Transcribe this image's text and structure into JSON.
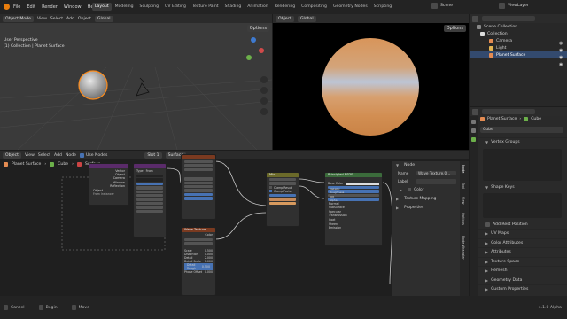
{
  "topbar": {
    "menus": [
      "File",
      "Edit",
      "Render",
      "Window",
      "Help"
    ],
    "workspaces": [
      "Layout",
      "Modeling",
      "Sculpting",
      "UV Editing",
      "Texture Paint",
      "Shading",
      "Animation",
      "Rendering",
      "Compositing",
      "Geometry Nodes",
      "Scripting"
    ],
    "active_workspace": "Layout",
    "scene_label": "Scene",
    "viewlayer_label": "ViewLayer"
  },
  "viewport3d": {
    "mode": "Object Mode",
    "menus": [
      "View",
      "Select",
      "Add",
      "Object"
    ],
    "transform": "Global",
    "options": "Options",
    "perspective": "User Perspective",
    "collection_info": "(1) Collection | Planet Surface"
  },
  "render_view": {
    "mode": "Object",
    "transform": "Global",
    "options": "Options"
  },
  "outliner": {
    "items": [
      {
        "label": "Scene Collection"
      },
      {
        "label": "Collection"
      },
      {
        "label": "Camera"
      },
      {
        "label": "Light"
      },
      {
        "label": "Planet Surface"
      }
    ]
  },
  "properties": {
    "object_name": "Planet Surface",
    "data_name": "Cube",
    "mesh_name": "Cube",
    "sections_top": [
      "Vertex Groups",
      "Shape Keys"
    ],
    "add_rest_position": "Add Rest Position",
    "sections_bottom": [
      "UV Maps",
      "Color Attributes",
      "Attributes",
      "Texture Space",
      "Remesh",
      "Geometry Data",
      "Custom Properties"
    ]
  },
  "node_editor": {
    "mode": "Object",
    "menus": [
      "View",
      "Select",
      "Add",
      "Node"
    ],
    "use_nodes_label": "Use Nodes",
    "slot": "Slot 1",
    "surface": "Surface",
    "breadcrumb": [
      "Planet Surface",
      "Cube",
      "Surface"
    ]
  },
  "node_sidebar": {
    "section_node": "Node",
    "name_label": "Name",
    "name_value": "Wave Texture.0...",
    "label_label": "Label",
    "color_label": "Color",
    "texture_mapping": "Texture Mapping",
    "properties": "Properties",
    "tabs": [
      "Node",
      "Tool",
      "View",
      "Options",
      "Node Wrangler"
    ]
  },
  "nodes": {
    "attribute_type": "Type",
    "attribute_from": "From",
    "attribute_labels": [
      "Vector",
      "Object",
      "Camera",
      "Window",
      "Reflection"
    ],
    "object_label": "Object",
    "from_instancer": "From Instancer",
    "rgb_label": "Mix",
    "principled": "Principled BSDF",
    "wave": "Wave Texture",
    "material_output": "Material Output",
    "mix_color": "Color",
    "clamp_result": "Clamp Result",
    "clamp_factor": "Clamp Factor",
    "bsdf_fields": [
      "Base Color",
      "Metallic",
      "Roughness",
      "IOR",
      "Alpha"
    ],
    "bsdf_sections": [
      "Normal",
      "Subsurface",
      "Specular",
      "Transmission",
      "Coat",
      "Sheen",
      "Emission"
    ],
    "wave_values": [
      "0.500",
      "0.000",
      "2.000",
      "1.000",
      "0.500",
      "0.000"
    ],
    "wave_labels": [
      "Scale",
      "Distortion",
      "Detail",
      "Detail Scale",
      "Detail Rough",
      "Phase Offset"
    ]
  },
  "statusbar": {
    "items": [
      "Cancel",
      "Begin",
      "Move"
    ],
    "version": "4.1.0 Alpha"
  },
  "colors": {
    "accent_blue": "#4772b3",
    "selection_orange": "#ff8c1a",
    "planet_orange": "#d8955a",
    "planet_light": "#bcc5d6",
    "principled_header": "#3b6b3b",
    "mix_header": "#6b6a2a",
    "wave_header": "#7a3a20",
    "attribute_header": "#5a2b6a"
  }
}
